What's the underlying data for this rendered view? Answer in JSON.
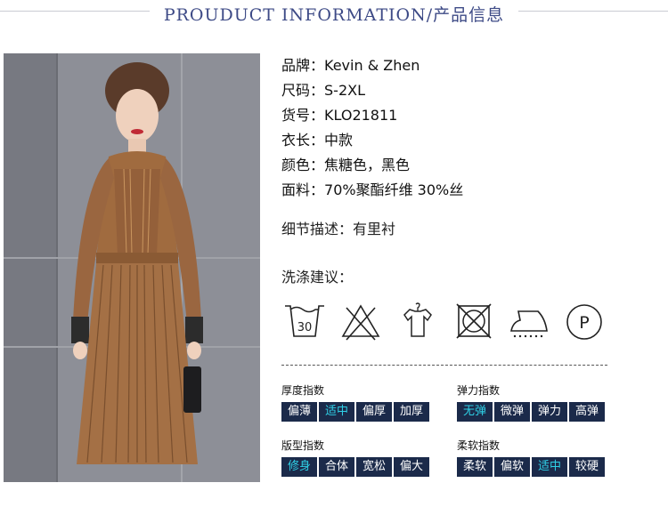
{
  "header": {
    "title": "PROUDUCT INFORMATION/产品信息"
  },
  "specs": [
    {
      "label": "品牌：",
      "value": "Kevin & Zhen"
    },
    {
      "label": "尺码：",
      "value": "S-2XL"
    },
    {
      "label": "货号：",
      "value": "KLO21811"
    },
    {
      "label": "衣长：",
      "value": "中款"
    },
    {
      "label": "颜色：",
      "value": "焦糖色，黑色"
    },
    {
      "label": "面料：",
      "value": "70%聚酯纤维 30%丝"
    }
  ],
  "detail": {
    "label": "细节描述：",
    "value": "有里衬"
  },
  "wash": {
    "title": "洗涤建议：",
    "icons": [
      "wash-30-icon",
      "no-bleach-icon",
      "hang-dry-icon",
      "no-tumble-dry-icon",
      "iron-icon",
      "dry-clean-p-icon"
    ],
    "wash_temp": "30",
    "dry_clean_letter": "P"
  },
  "indices": [
    {
      "title": "厚度指数",
      "options": [
        "偏薄",
        "适中",
        "偏厚",
        "加厚"
      ],
      "selected": 1
    },
    {
      "title": "弹力指数",
      "options": [
        "无弹",
        "微弹",
        "弹力",
        "高弹"
      ],
      "selected": 0
    },
    {
      "title": "版型指数",
      "options": [
        "修身",
        "合体",
        "宽松",
        "偏大"
      ],
      "selected": 0
    },
    {
      "title": "柔软指数",
      "options": [
        "柔软",
        "偏软",
        "适中",
        "较硬"
      ],
      "selected": 2
    }
  ],
  "colors": {
    "header_text": "#3d4a86",
    "option_bg": "#1b2a4a",
    "option_text": "#ffffff",
    "option_selected_text": "#2fd0e6"
  }
}
